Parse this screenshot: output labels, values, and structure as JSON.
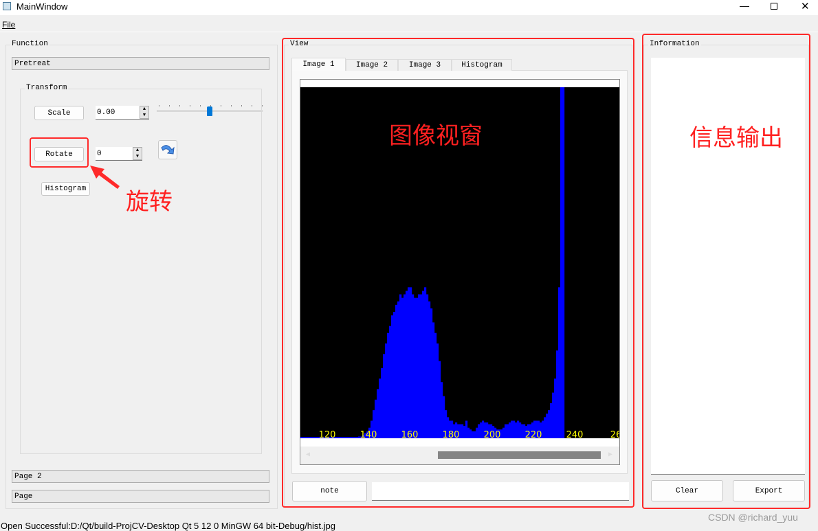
{
  "window": {
    "title": "MainWindow",
    "controls": [
      "minimize-icon",
      "maximize-icon",
      "close-icon"
    ]
  },
  "menu": {
    "items": [
      "File"
    ]
  },
  "function_panel": {
    "title": "Function",
    "pages": [
      "Pretreat",
      "Page 2",
      "Page"
    ],
    "transform": {
      "title": "Transform",
      "scale_label": "Scale",
      "scale_value": "0.00",
      "scale_slider_fraction": 0.5,
      "rotate_label": "Rotate",
      "rotate_value": "0",
      "histogram_label": "Histogram"
    }
  },
  "view_panel": {
    "title": "View",
    "tabs": [
      "Image 1",
      "Image 2",
      "Image 3",
      "Histogram"
    ],
    "active_tab": "Image 1",
    "note_label": "note",
    "note_input": "",
    "histogram_image": {
      "tick_labels": [
        "120",
        "140",
        "160",
        "180",
        "200",
        "220",
        "240",
        "26"
      ],
      "bar_color": "#0000ff",
      "background": "#000000",
      "tick_color": "#ffff00",
      "start_value": 135,
      "relative_counts": [
        0.005,
        0.005,
        0.01,
        0.015,
        0.02,
        0.03,
        0.05,
        0.08,
        0.11,
        0.14,
        0.17,
        0.2,
        0.24,
        0.27,
        0.3,
        0.32,
        0.35,
        0.36,
        0.38,
        0.39,
        0.41,
        0.4,
        0.41,
        0.42,
        0.43,
        0.43,
        0.41,
        0.4,
        0.4,
        0.41,
        0.41,
        0.42,
        0.43,
        0.41,
        0.39,
        0.37,
        0.33,
        0.3,
        0.27,
        0.22,
        0.16,
        0.12,
        0.08,
        0.06,
        0.05,
        0.05,
        0.04,
        0.045,
        0.04,
        0.04,
        0.04,
        0.035,
        0.05,
        0.03,
        0.025,
        0.02,
        0.02,
        0.03,
        0.04,
        0.045,
        0.05,
        0.045,
        0.045,
        0.04,
        0.04,
        0.035,
        0.03,
        0.025,
        0.025,
        0.025,
        0.03,
        0.04,
        0.04,
        0.045,
        0.05,
        0.05,
        0.045,
        0.05,
        0.045,
        0.04,
        0.04,
        0.035,
        0.04,
        0.04,
        0.045,
        0.05,
        0.05,
        0.05,
        0.045,
        0.05,
        0.06,
        0.07,
        0.08,
        0.1,
        0.13,
        0.17,
        0.25,
        0.43,
        1.0,
        1.0
      ]
    }
  },
  "info_panel": {
    "title": "Information",
    "text": "",
    "clear_label": "Clear",
    "export_label": "Export"
  },
  "annotations": {
    "rotate_note": "旋转",
    "view_note": "图像视窗",
    "info_note": "信息输出",
    "color": "#ff2020"
  },
  "status_bar": {
    "message": "Open Successful:D:/Qt/build-ProjCV-Desktop Qt 5 12 0 MinGW 64 bit-Debug/hist.jpg"
  },
  "watermark": "CSDN @richard_yuu"
}
